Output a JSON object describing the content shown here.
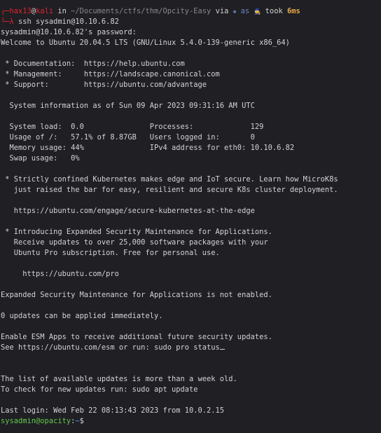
{
  "prompt": {
    "corner_top": "┌─",
    "corner_bottom": "└─",
    "user": "hax13",
    "at": "@",
    "host": "kali",
    "in_word": " in ",
    "directory": "~/Documents/ctfs/thm/Opcity-Easy",
    "via_word": " via ",
    "venv_icon": "✱",
    "venv_name": " as ",
    "wizard_icon": "🧙",
    "took_word": " took ",
    "duration": "6ms",
    "arrow": "λ",
    "command": " ssh sysadmin@10.10.6.82"
  },
  "output_lines": [
    "sysadmin@10.10.6.82's password:",
    "Welcome to Ubuntu 20.04.5 LTS (GNU/Linux 5.4.0-139-generic x86_64)",
    "",
    " * Documentation:  https://help.ubuntu.com",
    " * Management:     https://landscape.canonical.com",
    " * Support:        https://ubuntu.com/advantage",
    "",
    "  System information as of Sun 09 Apr 2023 09:31:16 AM UTC",
    "",
    "  System load:  0.0               Processes:             129",
    "  Usage of /:   57.1% of 8.87GB   Users logged in:       0",
    "  Memory usage: 44%               IPv4 address for eth0: 10.10.6.82",
    "  Swap usage:   0%",
    "",
    " * Strictly confined Kubernetes makes edge and IoT secure. Learn how MicroK8s",
    "   just raised the bar for easy, resilient and secure K8s cluster deployment.",
    "",
    "   https://ubuntu.com/engage/secure-kubernetes-at-the-edge",
    "",
    " * Introducing Expanded Security Maintenance for Applications.",
    "   Receive updates to over 25,000 software packages with your",
    "   Ubuntu Pro subscription. Free for personal use.",
    "",
    "     https://ubuntu.com/pro",
    "",
    "Expanded Security Maintenance for Applications is not enabled.",
    "",
    "0 updates can be applied immediately.",
    "",
    "Enable ESM Apps to receive additional future security updates.",
    "See https://ubuntu.com/esm or run: sudo pro status",
    "",
    "",
    "The list of available updates is more than a week old.",
    "To check for new updates run: sudo apt update",
    "",
    "Last login: Wed Feb 22 08:13:43 2023 from 10.0.2.15"
  ],
  "remote_prompt": {
    "user_host": "sysadmin@opacity",
    "separator": ":",
    "path": "~",
    "symbol": "$"
  },
  "colors": {
    "background": "#1f1f24",
    "foreground": "#d4d4d4",
    "prompt_red": "#e0242d",
    "remote_user_green": "#63c94b",
    "remote_path_blue": "#5c9cf5",
    "duration_orange": "#e7a94a"
  }
}
